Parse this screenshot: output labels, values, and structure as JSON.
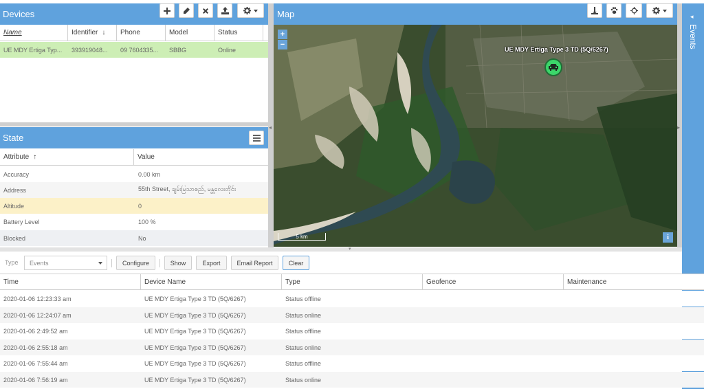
{
  "devices": {
    "title": "Devices",
    "columns": [
      "Name",
      "Identifier",
      "Phone",
      "Model",
      "Status"
    ],
    "rows": [
      {
        "name": "UE MDY Ertiga Typ...",
        "identifier": "393919048...",
        "phone": "09 7604335...",
        "model": "SBBG",
        "status": "Online"
      }
    ]
  },
  "state": {
    "title": "State",
    "columns": [
      "Attribute",
      "Value"
    ],
    "rows": [
      {
        "attribute": "Accuracy",
        "value": "0.00 km"
      },
      {
        "attribute": "Address",
        "value": "55th Street, ချမ်းမြသာစည်, မန္တလေးတိုင်း"
      },
      {
        "attribute": "Altitude",
        "value": "0"
      },
      {
        "attribute": "Battery Level",
        "value": "100 %"
      },
      {
        "attribute": "Blocked",
        "value": "No"
      }
    ]
  },
  "map": {
    "title": "Map",
    "marker_label": "UE MDY Ertiga Type 3 TD (5Q/6267)",
    "scale_label": "5 km",
    "zoom_in": "+",
    "zoom_out": "−",
    "info": "i"
  },
  "events_side": {
    "label": "Events"
  },
  "toolbar": {
    "type_label": "Type",
    "type_value": "Events",
    "configure": "Configure",
    "show": "Show",
    "export": "Export",
    "email_report": "Email Report",
    "clear": "Clear"
  },
  "events": {
    "columns": [
      "Time",
      "Device Name",
      "Type",
      "Geofence",
      "Maintenance"
    ],
    "rows": [
      {
        "time": "2020-01-06 12:23:33 am",
        "device": "UE MDY Ertiga Type 3 TD (5Q/6267)",
        "type": "Status offline",
        "geofence": "",
        "maintenance": ""
      },
      {
        "time": "2020-01-06 12:24:07 am",
        "device": "UE MDY Ertiga Type 3 TD (5Q/6267)",
        "type": "Status online",
        "geofence": "",
        "maintenance": ""
      },
      {
        "time": "2020-01-06 2:49:52 am",
        "device": "UE MDY Ertiga Type 3 TD (5Q/6267)",
        "type": "Status offline",
        "geofence": "",
        "maintenance": ""
      },
      {
        "time": "2020-01-06 2:55:18 am",
        "device": "UE MDY Ertiga Type 3 TD (5Q/6267)",
        "type": "Status online",
        "geofence": "",
        "maintenance": ""
      },
      {
        "time": "2020-01-06 7:55:44 am",
        "device": "UE MDY Ertiga Type 3 TD (5Q/6267)",
        "type": "Status offline",
        "geofence": "",
        "maintenance": ""
      },
      {
        "time": "2020-01-06 7:56:19 am",
        "device": "UE MDY Ertiga Type 3 TD (5Q/6267)",
        "type": "Status online",
        "geofence": "",
        "maintenance": ""
      }
    ]
  },
  "colors": {
    "header_blue": "#5fa2dd",
    "selected_row": "#cdeeb5",
    "highlight_row": "#fcf1c8",
    "marker": "#3cd66a"
  },
  "icons": {
    "devices_toolbar": [
      "plus-icon",
      "pencil-icon",
      "close-icon",
      "upload-icon",
      "gear-icon"
    ],
    "state_toolbar": [
      "list-icon"
    ],
    "map_toolbar": [
      "anchor-icon",
      "paw-icon",
      "crosshair-icon",
      "gear-icon"
    ]
  }
}
